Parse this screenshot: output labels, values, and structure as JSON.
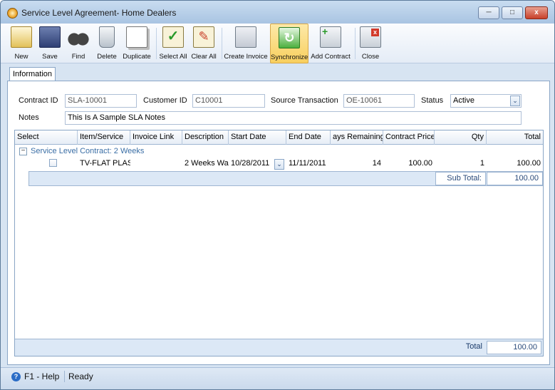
{
  "window": {
    "title": "Service Level Agreement- Home Dealers",
    "close_glyph": "x"
  },
  "toolbar": {
    "new": "New",
    "save": "Save",
    "find": "Find",
    "delete": "Delete",
    "duplicate": "Duplicate",
    "select_all": "Select All",
    "clear_all": "Clear All",
    "create_invoice": "Create Invoice",
    "synchronize": "Synchronize",
    "add_contract": "Add Contract",
    "close": "Close"
  },
  "tabs": {
    "information": "Information"
  },
  "form": {
    "contract_id_label": "Contract ID",
    "contract_id": "SLA-10001",
    "customer_id_label": "Customer ID",
    "customer_id": "C10001",
    "source_transaction_label": "Source Transaction",
    "source_transaction": "OE-10061",
    "status_label": "Status",
    "status": "Active",
    "notes_label": "Notes",
    "notes": "This Is A Sample SLA Notes"
  },
  "grid": {
    "headers": [
      "Select",
      "Item/Service",
      "Invoice Link",
      "Description",
      "Start Date",
      "End Date",
      "ays Remaining",
      "Contract Price",
      "Qty",
      "Total"
    ],
    "group_label": "Service Level Contract: 2 Weeks",
    "row": {
      "item": "TV-FLAT PLAS",
      "invoice_link": "",
      "description": "2 Weeks Wa",
      "start_date": "10/28/2011",
      "end_date": "11/11/2011",
      "days_remaining": "14",
      "contract_price": "100.00",
      "qty": "1",
      "total": "100.00"
    },
    "subtotal_label": "Sub Total:",
    "subtotal_value": "100.00",
    "total_label": "Total",
    "total_value": "100.00"
  },
  "status": {
    "help": "F1 - Help",
    "state": "Ready"
  },
  "colors": {
    "accent": "#3a6ea5",
    "active_tool": "#f8cf5e",
    "panel_border": "#8aa6c6"
  }
}
